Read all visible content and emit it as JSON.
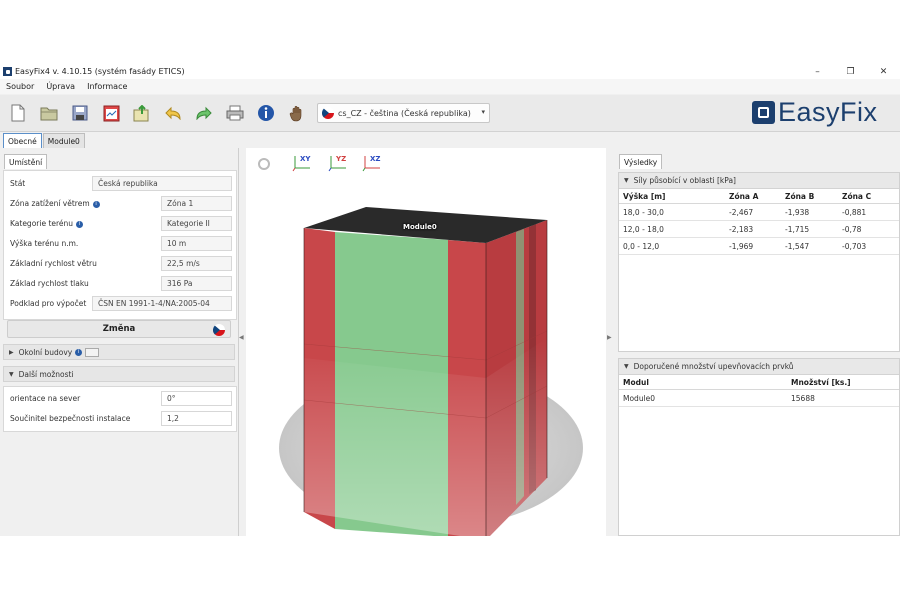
{
  "window": {
    "title": "EasyFix4 v. 4.10.15 (systém fasády ETICS)",
    "controls": {
      "minimize": "–",
      "maximize": "❐",
      "close": "✕"
    }
  },
  "menu": [
    "Soubor",
    "Úprava",
    "Informace"
  ],
  "toolbar": {
    "buttons": [
      "new-file-icon",
      "open-folder-icon",
      "save-icon",
      "report-icon",
      "export-icon",
      "undo-icon",
      "redo-icon",
      "print-icon",
      "info-icon",
      "help-hand-icon"
    ],
    "language": "cs_CZ - čeština (Česká republika)",
    "language_arrow": "▾"
  },
  "logo": {
    "text": "EasyFix",
    "color": "#1c3f6e"
  },
  "tabs": [
    "Obecné",
    "Module0"
  ],
  "location": {
    "tab": "Umístění",
    "fields": [
      {
        "label": "Stát",
        "value": "Česká republika"
      },
      {
        "label": "Zóna zatížení větrem",
        "value": "Zóna 1",
        "info": true
      },
      {
        "label": "Kategorie terénu",
        "value": "Kategorie II",
        "info": true
      },
      {
        "label": "Výška terénu n.m.",
        "value": "10 m"
      },
      {
        "label": "Základní rychlost větru",
        "value": "22,5 m/s"
      },
      {
        "label": "Základ rychlost tlaku",
        "value": "316 Pa"
      },
      {
        "label": "Podklad pro výpočet",
        "value": "ČSN EN 1991-1-4/NA:2005-04"
      }
    ],
    "change_button": "Změna"
  },
  "sections": {
    "neighbors": "Okolní budovy",
    "more": "Další možnosti"
  },
  "options": [
    {
      "label": "orientace na sever",
      "value": "0°"
    },
    {
      "label": "Součinitel bezpečnosti instalace",
      "value": "1,2"
    }
  ],
  "viewport": {
    "axes": [
      "XY",
      "YZ",
      "XZ"
    ],
    "model_label": "Module0",
    "colors": {
      "zone_a": "#c8474a",
      "zone_b": "#86c98e",
      "top": "#2a2a2a",
      "ground": "#d4d4d4"
    }
  },
  "results": {
    "tab": "Výsledky",
    "forces_title": "Síly působící v oblasti [kPa]",
    "forces_columns": [
      "Výška [m]",
      "Zóna A",
      "Zóna B",
      "Zóna C"
    ],
    "forces_rows": [
      [
        "18,0 - 30,0",
        "-2,467",
        "-1,938",
        "-0,881"
      ],
      [
        "12,0 - 18,0",
        "-2,183",
        "-1,715",
        "-0,78"
      ],
      [
        "0,0 - 12,0",
        "-1,969",
        "-1,547",
        "-0,703"
      ]
    ],
    "fixings_title": "Doporučené množství upevňovacích prvků",
    "fixings_columns": [
      "Modul",
      "Množství [ks.]"
    ],
    "fixings_rows": [
      [
        "Module0",
        "15688"
      ]
    ]
  }
}
